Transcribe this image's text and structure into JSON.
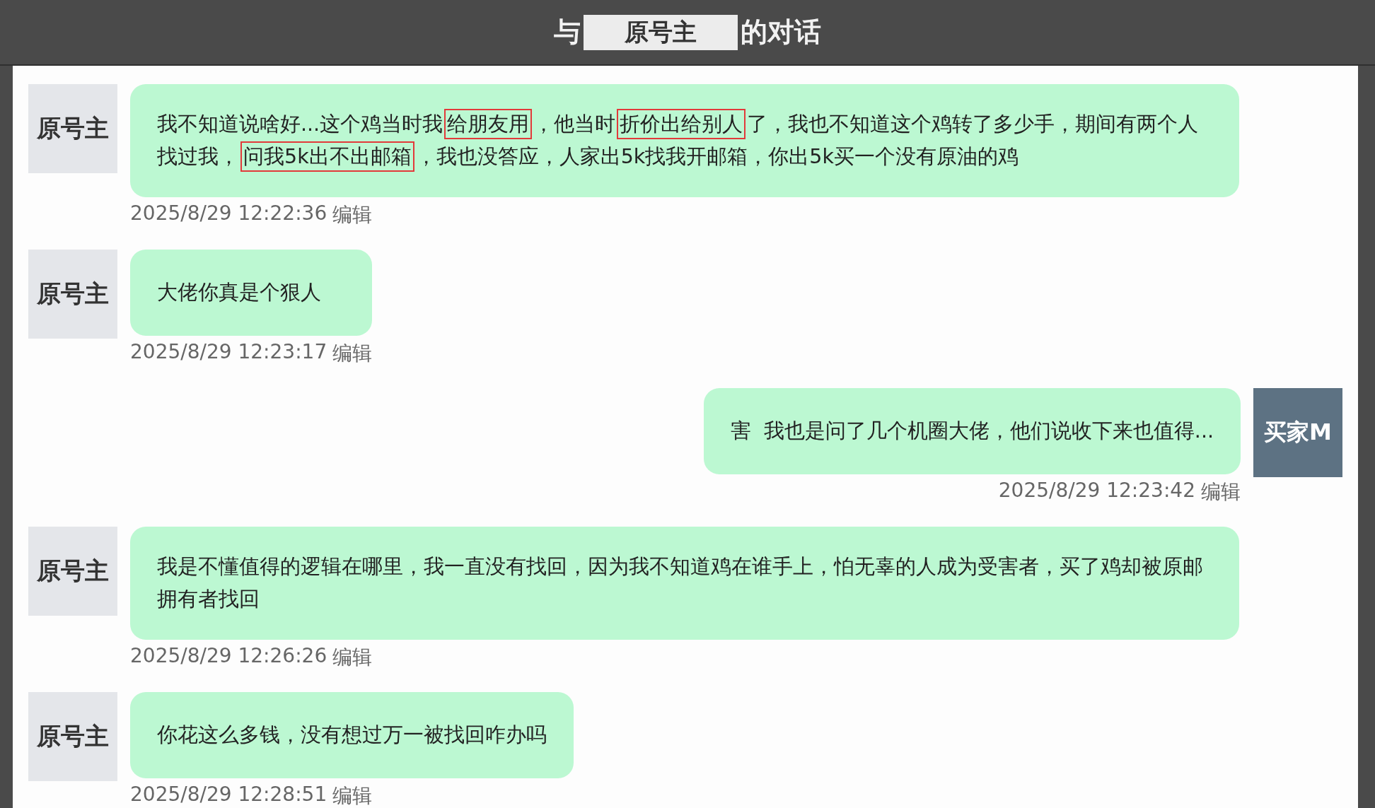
{
  "header": {
    "prefix": "与",
    "name": "原号主",
    "suffix": "的对话"
  },
  "messages": [
    {
      "kind": "incoming",
      "sender": "原号主",
      "segments": [
        {
          "text": "我不知道说啥好...这个鸡当时我",
          "boxed": false
        },
        {
          "text": "给朋友用",
          "boxed": true
        },
        {
          "text": "，他当时",
          "boxed": false
        },
        {
          "text": "折价出给别人",
          "boxed": true
        },
        {
          "text": "了，我也不知道这个鸡转了多少手，期间有两个人找过我，",
          "boxed": false
        },
        {
          "text": "问我5k出不出邮箱",
          "boxed": true
        },
        {
          "text": "，我也没答应，人家出5k找我开邮箱，你出5k买一个没有原油的鸡",
          "boxed": false
        }
      ],
      "time": "2025/8/29 12:22:36",
      "action": "编辑"
    },
    {
      "kind": "incoming",
      "sender": "原号主",
      "segments": [
        {
          "text": "大佬你真是个狠人",
          "boxed": false
        }
      ],
      "time": "2025/8/29 12:23:17",
      "action": "编辑"
    },
    {
      "kind": "outgoing",
      "sender": "买家M",
      "segments": [
        {
          "text": "害  我也是问了几个机圈大佬，他们说收下来也值得...",
          "boxed": false
        }
      ],
      "time": "2025/8/29 12:23:42",
      "action": "编辑"
    },
    {
      "kind": "incoming",
      "sender": "原号主",
      "segments": [
        {
          "text": "我是不懂值得的逻辑在哪里，我一直没有找回，因为我不知道鸡在谁手上，怕无辜的人成为受害者，买了鸡却被原邮拥有者找回",
          "boxed": false
        }
      ],
      "time": "2025/8/29 12:26:26",
      "action": "编辑"
    },
    {
      "kind": "incoming",
      "sender": "原号主",
      "segments": [
        {
          "text": "你花这么多钱，没有想过万一被找回咋办吗",
          "boxed": false
        }
      ],
      "time": "2025/8/29 12:28:51",
      "action": "编辑"
    }
  ]
}
